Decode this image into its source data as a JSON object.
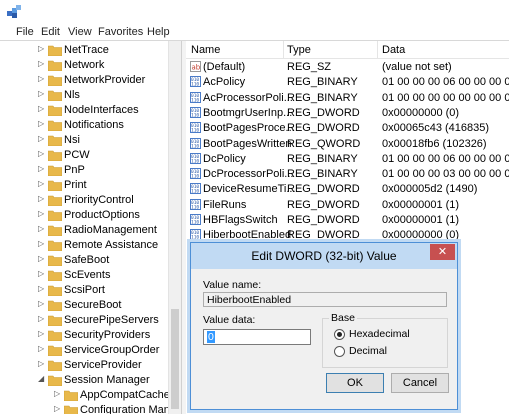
{
  "menu": [
    "File",
    "Edit",
    "View",
    "Favorites",
    "Help"
  ],
  "tree": [
    {
      "label": "NetTrace"
    },
    {
      "label": "Network"
    },
    {
      "label": "NetworkProvider"
    },
    {
      "label": "Nls"
    },
    {
      "label": "NodeInterfaces"
    },
    {
      "label": "Notifications"
    },
    {
      "label": "Nsi"
    },
    {
      "label": "PCW"
    },
    {
      "label": "PnP"
    },
    {
      "label": "Print"
    },
    {
      "label": "PriorityControl"
    },
    {
      "label": "ProductOptions"
    },
    {
      "label": "RadioManagement"
    },
    {
      "label": "Remote Assistance"
    },
    {
      "label": "SafeBoot"
    },
    {
      "label": "ScEvents"
    },
    {
      "label": "ScsiPort"
    },
    {
      "label": "SecureBoot"
    },
    {
      "label": "SecurePipeServers"
    },
    {
      "label": "SecurityProviders"
    },
    {
      "label": "ServiceGroupOrder"
    },
    {
      "label": "ServiceProvider"
    },
    {
      "label": "Session Manager"
    },
    {
      "label": "AppCompatCache"
    },
    {
      "label": "Configuration Manag"
    }
  ],
  "columns": {
    "name": "Name",
    "type": "Type",
    "data": "Data"
  },
  "rows": [
    {
      "name": "(Default)",
      "type": "REG_SZ",
      "data": "(value not set)",
      "icon": "string-value-icon"
    },
    {
      "name": "AcPolicy",
      "type": "REG_BINARY",
      "data": "01 00 00 00 06 00 00 00 03 00 00",
      "icon": "binary-value-icon"
    },
    {
      "name": "AcProcessorPoli...",
      "type": "REG_BINARY",
      "data": "01 00 00 00 00 00 00 00 00 00 00",
      "icon": "binary-value-icon"
    },
    {
      "name": "BootmgrUserInp...",
      "type": "REG_DWORD",
      "data": "0x00000000 (0)",
      "icon": "binary-value-icon"
    },
    {
      "name": "BootPagesProce...",
      "type": "REG_DWORD",
      "data": "0x00065c43 (416835)",
      "icon": "binary-value-icon"
    },
    {
      "name": "BootPagesWritten",
      "type": "REG_QWORD",
      "data": "0x00018fb6 (102326)",
      "icon": "binary-value-icon"
    },
    {
      "name": "DcPolicy",
      "type": "REG_BINARY",
      "data": "01 00 00 00 06 00 00 00 03 00 00",
      "icon": "binary-value-icon"
    },
    {
      "name": "DcProcessorPoli...",
      "type": "REG_BINARY",
      "data": "01 00 00 00 03 00 00 00 00 00 00",
      "icon": "binary-value-icon"
    },
    {
      "name": "DeviceResumeTi...",
      "type": "REG_DWORD",
      "data": "0x000005d2 (1490)",
      "icon": "binary-value-icon"
    },
    {
      "name": "FileRuns",
      "type": "REG_DWORD",
      "data": "0x00000001 (1)",
      "icon": "binary-value-icon"
    },
    {
      "name": "HBFlagsSwitch",
      "type": "REG_DWORD",
      "data": "0x00000001 (1)",
      "icon": "binary-value-icon"
    },
    {
      "name": "HiberbootEnabled",
      "type": "REG_DWORD",
      "data": "0x00000000 (0)",
      "icon": "binary-value-icon"
    }
  ],
  "dialog": {
    "title": "Edit DWORD (32-bit) Value",
    "close": "✕",
    "value_name_label": "Value name:",
    "value_name": "HiberbootEnabled",
    "value_data_label": "Value data:",
    "value_data": "0",
    "base_label": "Base",
    "hex_label": "Hexadecimal",
    "dec_label": "Decimal",
    "ok_label": "OK",
    "cancel_label": "Cancel"
  },
  "colors": {
    "folder": "#e8b84a",
    "accent": "#c1daf3",
    "close": "#c75050"
  }
}
